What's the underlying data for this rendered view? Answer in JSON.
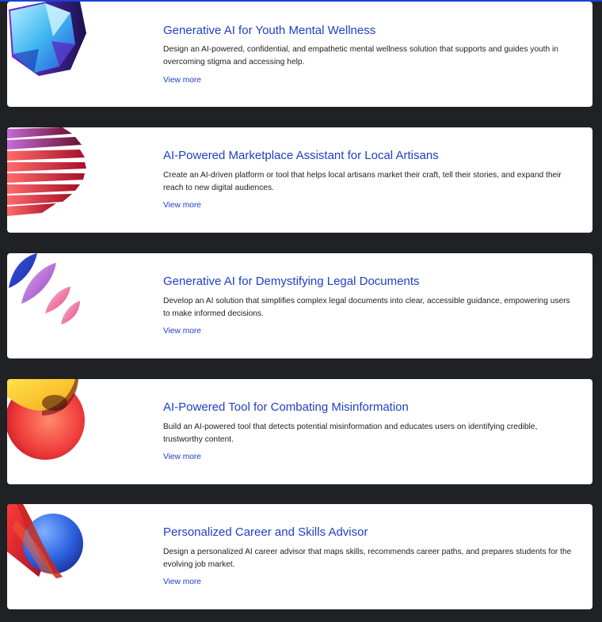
{
  "challenges": [
    {
      "title": "Generative AI for Youth Mental Wellness",
      "description": "Design an AI-powered, confidential, and empathetic mental wellness solution that supports and guides youth in overcoming stigma and accessing help.",
      "link": "View more",
      "art_icon": "blue-crystal-icon"
    },
    {
      "title": "AI-Powered Marketplace Assistant for Local Artisans",
      "description": "Create an AI-driven platform or tool that helps local artisans market their craft, tell their stories, and expand their reach to new digital audiences.",
      "link": "View more",
      "art_icon": "red-fan-icon"
    },
    {
      "title": "Generative AI for Demystifying Legal Documents",
      "description": "Develop an AI solution that simplifies complex legal documents into clear, accessible guidance, empowering users to make informed decisions.",
      "link": "View more",
      "art_icon": "pink-petals-icon"
    },
    {
      "title": "AI-Powered Tool for Combating Misinformation",
      "description": "Build an AI-powered tool that detects potential misinformation and educates users on identifying credible, trustworthy content.",
      "link": "View more",
      "art_icon": "yellow-red-swirl-icon"
    },
    {
      "title": "Personalized Career and Skills Advisor",
      "description": "Design a personalized AI career advisor that maps skills, recommends career paths, and prepares students for the evolving job market.",
      "link": "View more",
      "art_icon": "blue-sphere-icon"
    }
  ],
  "colors": {
    "background": "#202124",
    "card": "#ffffff",
    "link": "#1f40c6",
    "accent_bar": "#1a3fd8"
  }
}
